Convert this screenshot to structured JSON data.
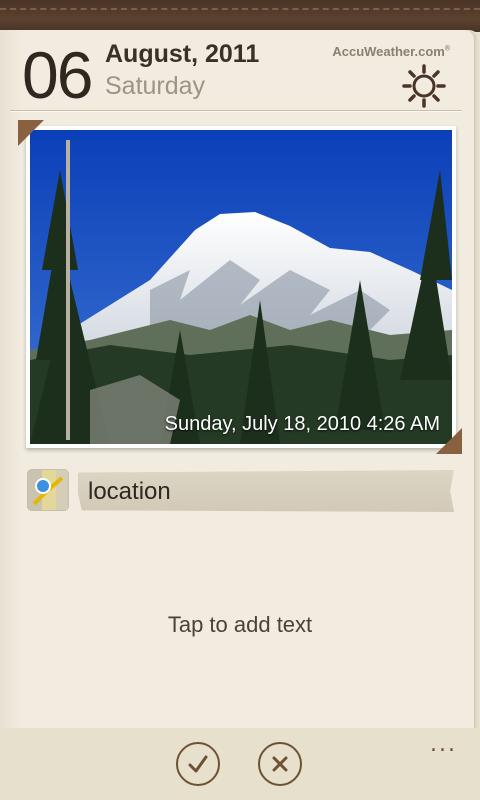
{
  "header": {
    "day": "06",
    "month_year": "August, 2011",
    "weekday": "Saturday",
    "weather_brand": "AccuWeather.com",
    "weather_icon": "sun-icon"
  },
  "photo": {
    "caption": "Sunday, July 18, 2010 4:26 AM"
  },
  "location": {
    "label": "location",
    "icon": "map-icon"
  },
  "note": {
    "placeholder": "Tap to add text"
  },
  "appbar": {
    "confirm_icon": "check-icon",
    "cancel_icon": "close-icon",
    "more_icon": "more-icon",
    "more_label": "..."
  },
  "colors": {
    "leather": "#4a3426",
    "paper": "#f1ecdf",
    "accent": "#6e5135"
  }
}
